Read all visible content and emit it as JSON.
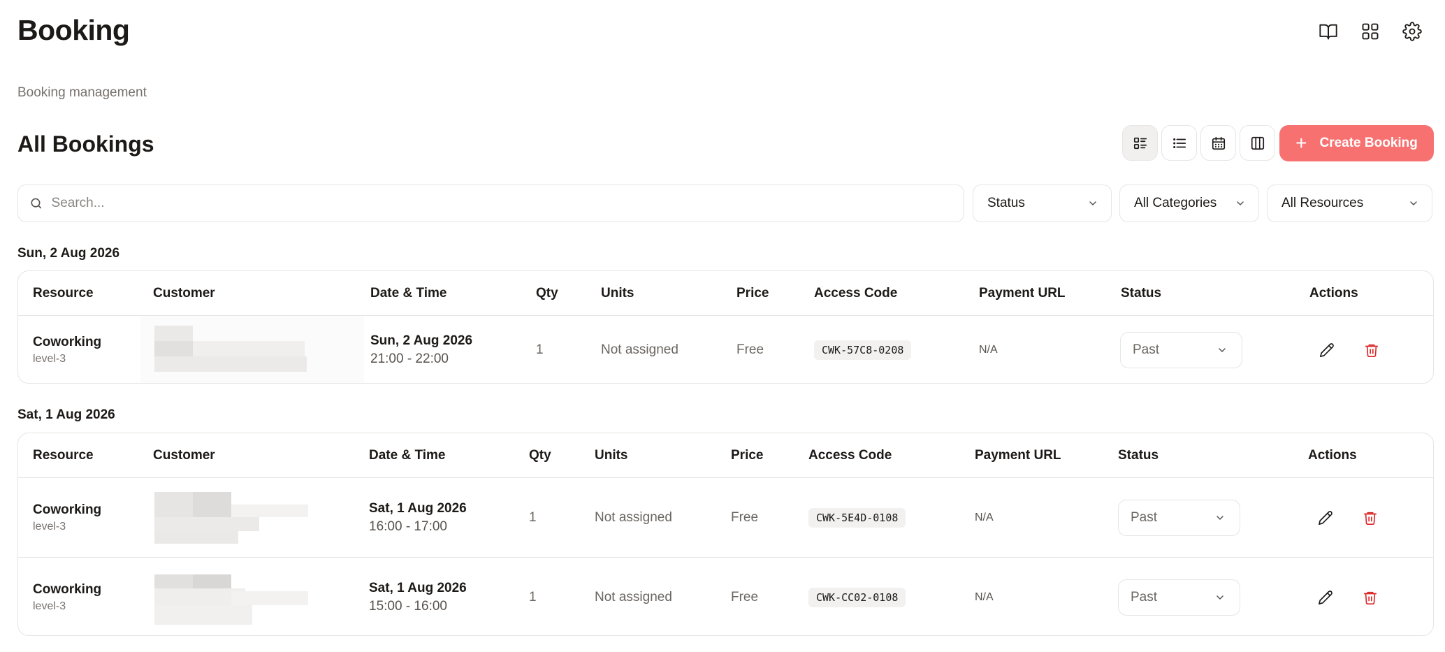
{
  "header": {
    "title": "Booking",
    "subtitle": "Booking management",
    "icons": [
      "book-open-icon",
      "grid-icon",
      "gear-icon"
    ]
  },
  "section": {
    "title": "All Bookings",
    "create_label": "Create Booking",
    "views": [
      "list-detail-view",
      "list-view",
      "calendar-view",
      "columns-view"
    ],
    "active_view": "list-detail-view"
  },
  "filters": {
    "search_placeholder": "Search...",
    "status": "Status",
    "categories": "All Categories",
    "resources": "All Resources"
  },
  "columns": [
    "Resource",
    "Customer",
    "Date & Time",
    "Qty",
    "Units",
    "Price",
    "Access Code",
    "Payment URL",
    "Status",
    "Actions"
  ],
  "groups": [
    {
      "date": "Sun, 2 Aug 2026",
      "rows": [
        {
          "resource": "Coworking",
          "level": "level-3",
          "date": "Sun, 2 Aug 2026",
          "time": "21:00 - 22:00",
          "qty": "1",
          "units": "Not assigned",
          "price": "Free",
          "code": "CWK-57C8-0208",
          "payment": "N/A",
          "status": "Past"
        }
      ]
    },
    {
      "date": "Sat, 1 Aug 2026",
      "rows": [
        {
          "resource": "Coworking",
          "level": "level-3",
          "date": "Sat, 1 Aug 2026",
          "time": "16:00 - 17:00",
          "qty": "1",
          "units": "Not assigned",
          "price": "Free",
          "code": "CWK-5E4D-0108",
          "payment": "N/A",
          "status": "Past"
        },
        {
          "resource": "Coworking",
          "level": "level-3",
          "date": "Sat, 1 Aug 2026",
          "time": "15:00 - 16:00",
          "qty": "1",
          "units": "Not assigned",
          "price": "Free",
          "code": "CWK-CC02-0108",
          "payment": "N/A",
          "status": "Past"
        }
      ]
    }
  ],
  "colors": {
    "accent": "#f87171",
    "danger": "#dc2626",
    "border": "#e7e5e4"
  }
}
